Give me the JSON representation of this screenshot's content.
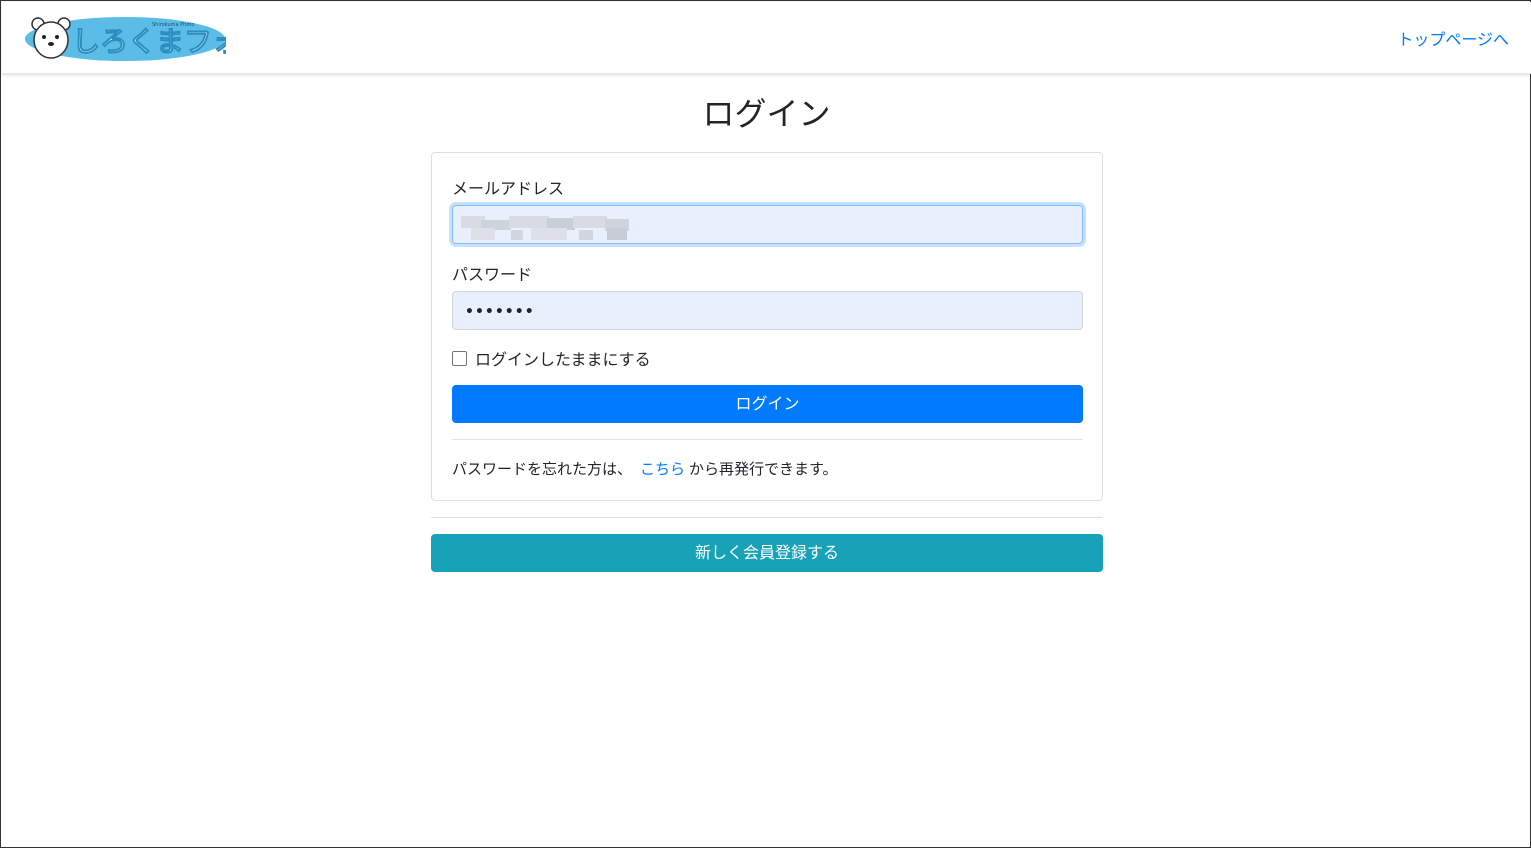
{
  "header": {
    "logo_text": "しろくまフォト",
    "logo_subtext": "Shirokuma Photo",
    "top_page_link": "トップページへ"
  },
  "page": {
    "title": "ログイン"
  },
  "form": {
    "email_label": "メールアドレス",
    "email_value": "",
    "password_label": "パスワード",
    "password_value": "•••••••",
    "remember_label": "ログインしたままにする",
    "remember_checked": false,
    "login_button": "ログイン",
    "forgot_prefix": "パスワードを忘れた方は、",
    "forgot_link": "こちら",
    "forgot_suffix": "から再発行できます。"
  },
  "register": {
    "button_label": "新しく会員登録する"
  },
  "colors": {
    "primary": "#007bff",
    "info": "#17a2b8",
    "autofill_bg": "#e8f0fe",
    "logo_blue": "#5bbde6"
  }
}
